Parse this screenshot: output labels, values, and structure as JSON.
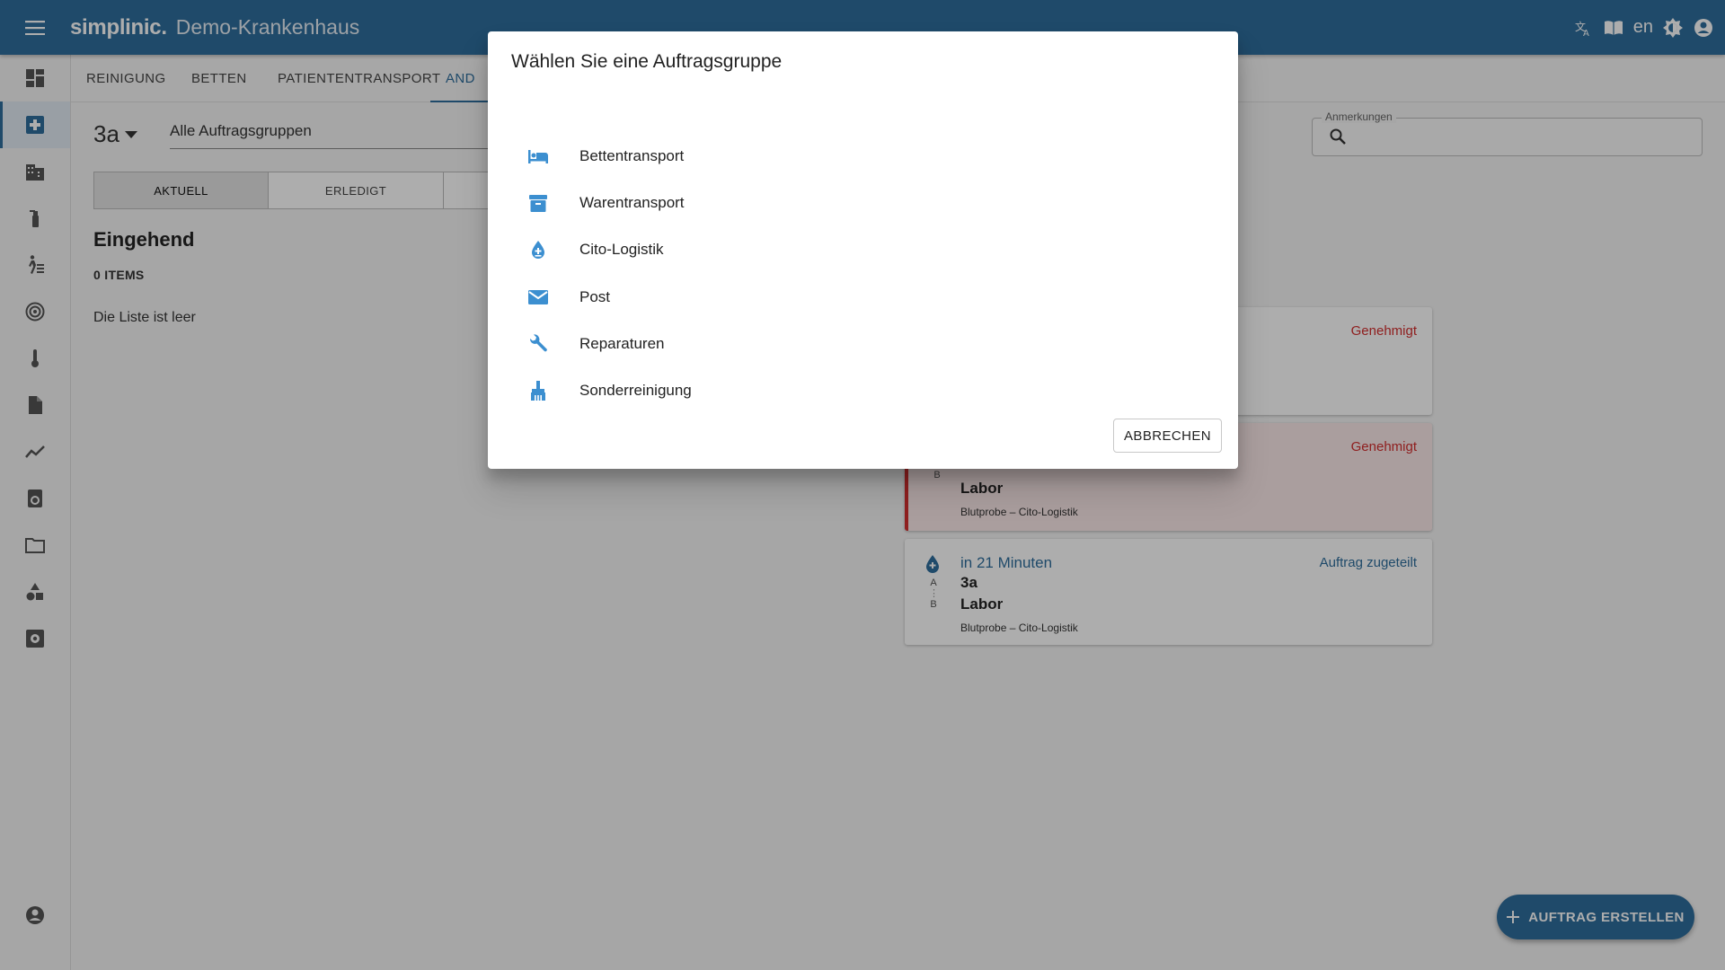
{
  "header": {
    "brand": "simplinic.",
    "hospital": "Demo-Krankenhaus",
    "language": "en"
  },
  "sidebar": {
    "items": [
      {
        "icon": "dashboard-icon"
      },
      {
        "icon": "medical-plus-icon",
        "active": true
      },
      {
        "icon": "building-icon"
      },
      {
        "icon": "cleaning-spray-icon"
      },
      {
        "icon": "patient-transport-icon"
      },
      {
        "icon": "target-icon"
      },
      {
        "icon": "thermometer-icon"
      },
      {
        "icon": "document-icon"
      },
      {
        "icon": "trend-icon"
      },
      {
        "icon": "laundry-icon"
      },
      {
        "icon": "folder-icon"
      },
      {
        "icon": "shapes-icon"
      },
      {
        "icon": "settings-icon"
      },
      {
        "icon": "account-icon"
      }
    ]
  },
  "tabs": [
    "REINIGUNG",
    "BETTEN",
    "PATIENTENTRANSPORT",
    "AND"
  ],
  "ward": "3a",
  "group_filter": "Alle Auftragsgruppen",
  "segments": [
    "AKTUELL",
    "ERLEDIGT"
  ],
  "incoming": {
    "title": "Eingehend",
    "count": "0 ITEMS",
    "empty": "Die Liste ist leer"
  },
  "remarks": {
    "label": "Anmerkungen"
  },
  "orders": [
    {
      "status": "Genehmigt"
    },
    {
      "status": "Genehmigt",
      "to": "Labor",
      "desc": "Blutprobe – Cito-Logistik"
    },
    {
      "time": "in 21 Minuten",
      "status": "Auftrag zugeteilt",
      "from": "3a",
      "to": "Labor",
      "desc": "Blutprobe – Cito-Logistik"
    }
  ],
  "ab_labels": {
    "a": "A",
    "b": "B"
  },
  "fab": {
    "label": "AUFTRAG ERSTELLEN"
  },
  "dialog": {
    "title": "Wählen Sie eine Auftragsgruppe",
    "items": [
      {
        "label": "Bettentransport",
        "icon": "bed-icon"
      },
      {
        "label": "Warentransport",
        "icon": "archive-icon"
      },
      {
        "label": "Cito-Logistik",
        "icon": "blood-drop-icon"
      },
      {
        "label": "Post",
        "icon": "mail-icon"
      },
      {
        "label": "Reparaturen",
        "icon": "wrench-icon"
      },
      {
        "label": "Sonderreinigung",
        "icon": "cleaning-icon"
      }
    ],
    "cancel": "ABBRECHEN"
  },
  "colors": {
    "primary": "#2f6e9c",
    "alert": "#d32f2f",
    "icon_blue": "#3c8fd0"
  }
}
